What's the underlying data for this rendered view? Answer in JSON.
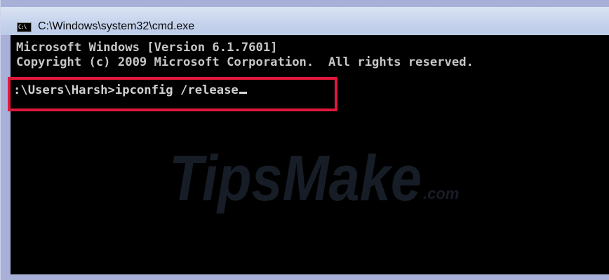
{
  "window": {
    "title": "C:\\Windows\\system32\\cmd.exe",
    "icon": "cmd-icon",
    "icon_text": "C:\\"
  },
  "console": {
    "line1": "Microsoft Windows [Version 6.1.7601]",
    "line2": "Copyright (c) 2009 Microsoft Corporation.  All rights reserved.",
    "prompt_command": ":\\Users\\Harsh>ipconfig /release"
  },
  "watermark": {
    "brand_main": "TipsMake",
    "brand_suffix": ".com"
  },
  "colors": {
    "console_bg": "#000000",
    "console_text": "#c6c6c6",
    "highlight": "#e0183c",
    "titlebar": "#c6d3ec"
  }
}
